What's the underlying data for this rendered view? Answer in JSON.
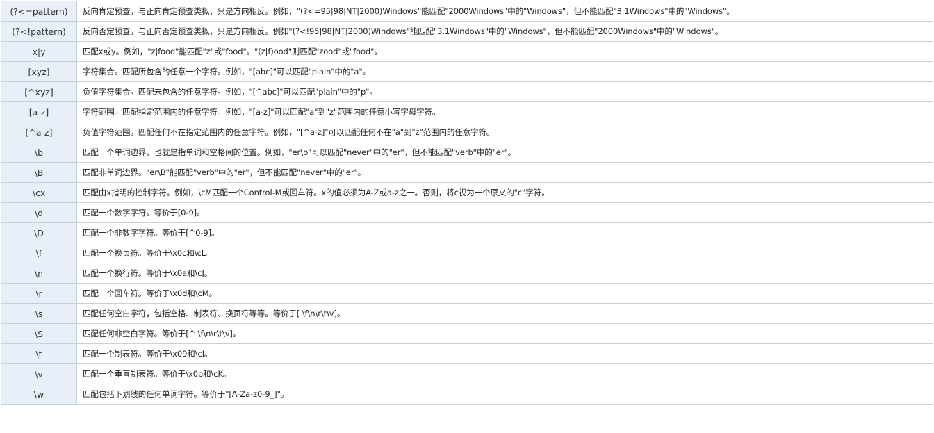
{
  "rows": [
    {
      "syntax": "(?<=pattern)",
      "desc": "反向肯定预查，与正向肯定预查类拟，只是方向相反。例如，\"(?<=95|98|NT|2000)Windows\"能匹配\"2000Windows\"中的\"Windows\"，但不能匹配\"3.1Windows\"中的\"Windows\"。"
    },
    {
      "syntax": "(?<!pattern)",
      "desc": "反向否定预查，与正向否定预查类拟，只是方向相反。例如\"(?<!95|98|NT|2000)Windows\"能匹配\"3.1Windows\"中的\"Windows\"，但不能匹配\"2000Windows\"中的\"Windows\"。"
    },
    {
      "syntax": "x|y",
      "desc": "匹配x或y。例如，\"z|food\"能匹配\"z\"或\"food\"。\"(z|f)ood\"则匹配\"zood\"或\"food\"。"
    },
    {
      "syntax": "[xyz]",
      "desc": "字符集合。匹配所包含的任意一个字符。例如，\"[abc]\"可以匹配\"plain\"中的\"a\"。"
    },
    {
      "syntax": "[^xyz]",
      "desc": "负值字符集合。匹配未包含的任意字符。例如，\"[^abc]\"可以匹配\"plain\"中的\"p\"。"
    },
    {
      "syntax": "[a-z]",
      "desc": "字符范围。匹配指定范围内的任意字符。例如，\"[a-z]\"可以匹配\"a\"到\"z\"范围内的任意小写字母字符。"
    },
    {
      "syntax": "[^a-z]",
      "desc": "负值字符范围。匹配任何不在指定范围内的任意字符。例如，\"[^a-z]\"可以匹配任何不在\"a\"到\"z\"范围内的任意字符。"
    },
    {
      "syntax": "\\b",
      "desc": "匹配一个单词边界，也就是指单词和空格间的位置。例如，\"er\\b\"可以匹配\"never\"中的\"er\"，但不能匹配\"verb\"中的\"er\"。"
    },
    {
      "syntax": "\\B",
      "desc": "匹配非单词边界。\"er\\B\"能匹配\"verb\"中的\"er\"，但不能匹配\"never\"中的\"er\"。"
    },
    {
      "syntax": "\\cx",
      "desc": "匹配由x指明的控制字符。例如，\\cM匹配一个Control-M或回车符。x的值必须为A-Z或a-z之一。否则，将c视为一个原义的\"c\"字符。"
    },
    {
      "syntax": "\\d",
      "desc": "匹配一个数字字符。等价于[0-9]。"
    },
    {
      "syntax": "\\D",
      "desc": "匹配一个非数字字符。等价于[^0-9]。"
    },
    {
      "syntax": "\\f",
      "desc": "匹配一个换页符。等价于\\x0c和\\cL。"
    },
    {
      "syntax": "\\n",
      "desc": "匹配一个换行符。等价于\\x0a和\\cJ。"
    },
    {
      "syntax": "\\r",
      "desc": "匹配一个回车符。等价于\\x0d和\\cM。"
    },
    {
      "syntax": "\\s",
      "desc": "匹配任何空白字符，包括空格、制表符、换页符等等。等价于[ \\f\\n\\r\\t\\v]。"
    },
    {
      "syntax": "\\S",
      "desc": "匹配任何非空白字符。等价于[^ \\f\\n\\r\\t\\v]。"
    },
    {
      "syntax": "\\t",
      "desc": "匹配一个制表符。等价于\\x09和\\cI。"
    },
    {
      "syntax": "\\v",
      "desc": "匹配一个垂直制表符。等价于\\x0b和\\cK。"
    },
    {
      "syntax": "\\w",
      "desc": "匹配包括下划线的任何单词字符。等价于\"[A-Za-z0-9_]\"。"
    }
  ]
}
